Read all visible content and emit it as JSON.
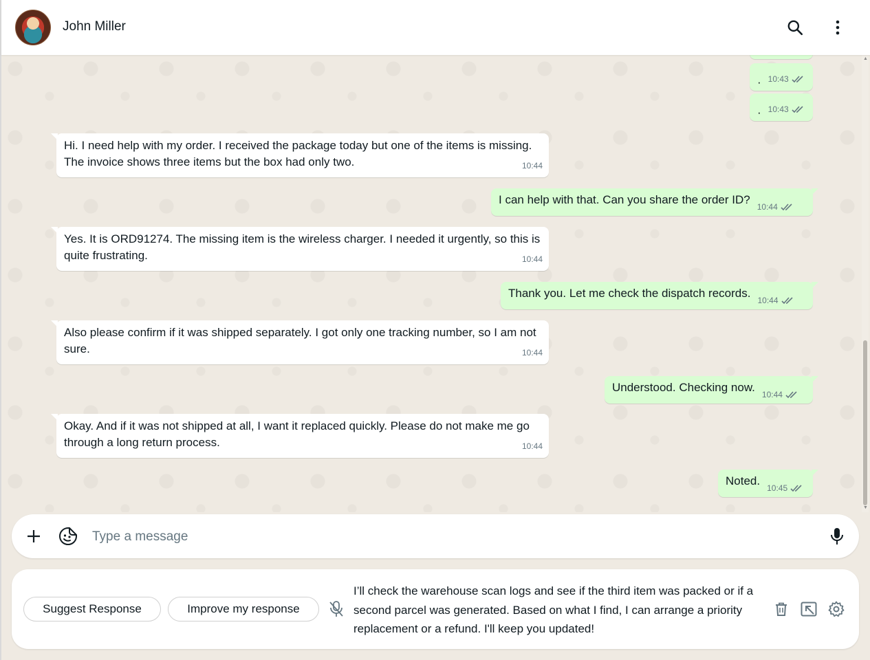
{
  "header": {
    "contact_name": "John Miller",
    "icons": [
      "search-icon",
      "kebab-menu-icon"
    ]
  },
  "messages": [
    {
      "direction": "out",
      "text": "·",
      "time": "10:43",
      "status": "read"
    },
    {
      "direction": "out",
      "text": "·",
      "time": "10:43",
      "status": "read"
    },
    {
      "direction": "in",
      "text": "Hi. I need help with my order. I received the package today but one of the items is missing. The invoice shows three items but the box had only two.",
      "time": "10:44"
    },
    {
      "direction": "out",
      "text": "I can help with that. Can you share the order ID?",
      "time": "10:44",
      "status": "read"
    },
    {
      "direction": "in",
      "text": "Yes. It is ORD91274. The missing item is the wireless charger. I needed it urgently, so this is quite frustrating.",
      "time": "10:44"
    },
    {
      "direction": "out",
      "text": "Thank you. Let me check the dispatch records.",
      "time": "10:44",
      "status": "read"
    },
    {
      "direction": "in",
      "text": "Also please confirm if it was shipped separately. I got only one tracking number, so I am not sure.",
      "time": "10:44"
    },
    {
      "direction": "out",
      "text": "Understood. Checking now.",
      "time": "10:44",
      "status": "read"
    },
    {
      "direction": "in",
      "text": "Okay. And if it was not shipped at all, I want it replaced quickly. Please do not make me go through a long return process.",
      "time": "10:44"
    },
    {
      "direction": "out",
      "text": "Noted.",
      "time": "10:45",
      "status": "read"
    }
  ],
  "composer": {
    "placeholder": "Type a message"
  },
  "assistant": {
    "suggest_label": "Suggest Response",
    "improve_label": "Improve my response",
    "suggestion_text": "I’ll check the warehouse scan logs and see if the third item was packed or if a second parcel was generated. Based on what I find, I can arrange a priority replacement or a refund. I'll keep you updated!"
  },
  "colors": {
    "outgoing_bubble": "#d9fdd3",
    "incoming_bubble": "#ffffff",
    "chat_background": "#efeae2",
    "read_tick": "#667781"
  }
}
